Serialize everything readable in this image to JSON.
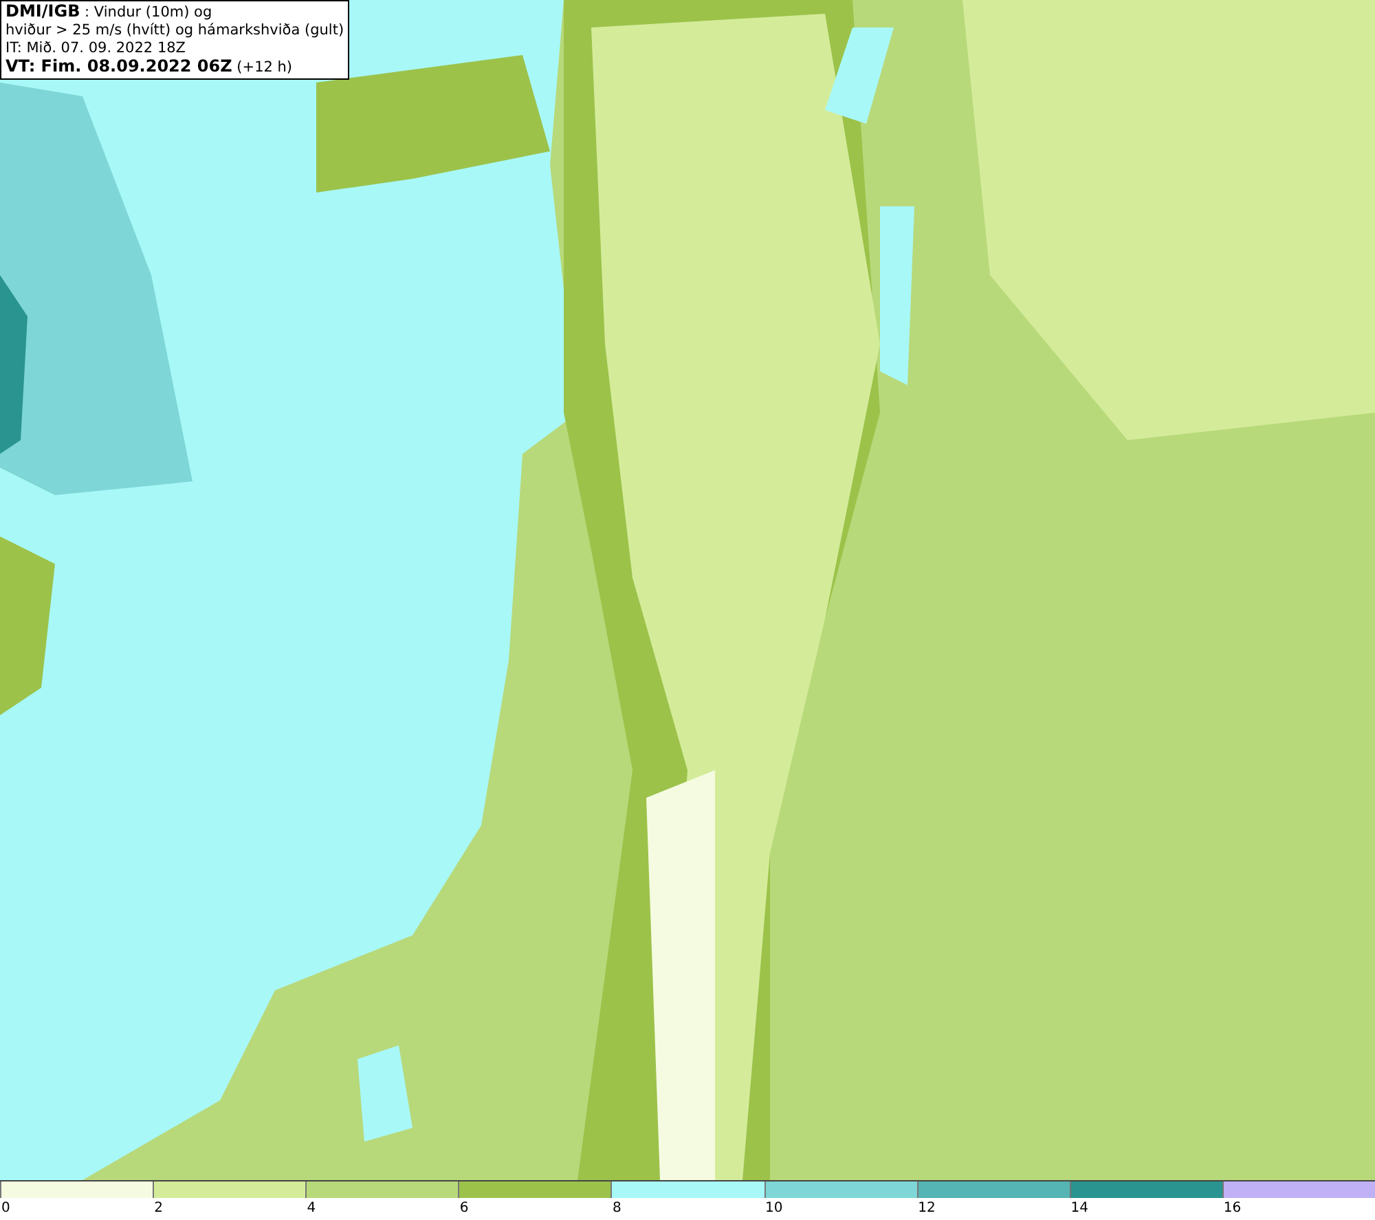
{
  "title_box": {
    "lines": [
      "**DMI/IGB** : Vindur (10m) og",
      "hviður > 25 m/s (hvítt) og hámarkshviða (gult)",
      "IT: Mið. 07. 09. 2022 18Z",
      "**VT: Fim. 08.09.2022 06Z** (+12 h)"
    ]
  },
  "legend": {
    "items": [
      {
        "label": "0",
        "color": "#f5fbe0"
      },
      {
        "label": "2",
        "color": "#d4ec9a"
      },
      {
        "label": "4",
        "color": "#b8d97a"
      },
      {
        "label": "6",
        "color": "#9cc24a"
      },
      {
        "label": "8",
        "color": "#a8f8f8"
      },
      {
        "label": "10",
        "color": "#7fd6d6"
      },
      {
        "label": "12",
        "color": "#55b4b4"
      },
      {
        "label": "14",
        "color": "#2a9490"
      },
      {
        "label": "16",
        "color": "#c0b0f5"
      }
    ]
  }
}
